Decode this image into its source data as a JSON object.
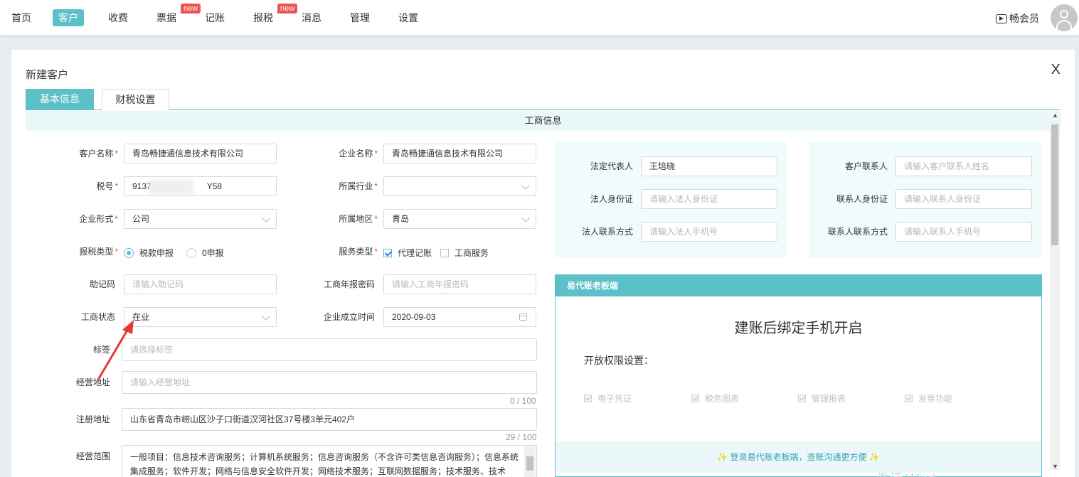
{
  "nav": {
    "items": [
      {
        "label": "首页",
        "active": false
      },
      {
        "label": "客户",
        "active": true
      },
      {
        "label": "收费",
        "active": false
      },
      {
        "label": "票据",
        "active": false,
        "badge": "new"
      },
      {
        "label": "记账",
        "active": false
      },
      {
        "label": "报税",
        "active": false,
        "badge": "new"
      },
      {
        "label": "消息",
        "active": false
      },
      {
        "label": "管理",
        "active": false
      },
      {
        "label": "设置",
        "active": false
      }
    ],
    "vip_label": "畅会员"
  },
  "modal": {
    "title": "新建客户",
    "close": "X",
    "tabs": [
      "基本信息",
      "财税设置"
    ],
    "section_title": "工商信息"
  },
  "form": {
    "customer_name": {
      "label": "客户名称",
      "value": "青岛畅捷通信息技术有限公司"
    },
    "company_name": {
      "label": "企业名称",
      "value": "青岛畅捷通信息技术有限公司"
    },
    "tax_no": {
      "label": "税号",
      "value_start": "9137",
      "value_end": "Y58"
    },
    "industry": {
      "label": "所属行业",
      "value": ""
    },
    "company_form": {
      "label": "企业形式",
      "value": "公司"
    },
    "region": {
      "label": "所属地区",
      "value": "青岛"
    },
    "tax_type": {
      "label": "报税类型",
      "options": [
        "税款申报",
        "0申报"
      ],
      "selected": "税款申报"
    },
    "service_type": {
      "label": "服务类型",
      "options": [
        "代理记账",
        "工商服务"
      ],
      "checked": [
        "代理记账"
      ]
    },
    "mnemonic": {
      "label": "助记码",
      "placeholder": "请输入助记码"
    },
    "annual_report_pwd": {
      "label": "工商年报密码",
      "placeholder": "请输入工商年报密码"
    },
    "biz_status": {
      "label": "工商状态",
      "value": "在业"
    },
    "founded": {
      "label": "企业成立时间",
      "value": "2020-09-03"
    },
    "tags": {
      "label": "标签",
      "placeholder": "请选择标签"
    },
    "biz_address": {
      "label": "经营地址",
      "placeholder": "请输入经营地址",
      "counter": "0 / 100"
    },
    "reg_address": {
      "label": "注册地址",
      "value": "山东省青岛市崂山区沙子口街道汉河社区37号楼3单元402户",
      "counter": "29 / 100"
    },
    "biz_scope": {
      "label": "经营范围",
      "value": "一般项目：信息技术咨询服务；计算机系统服务；信息咨询服务（不含许可类信息咨询服务）；信息系统集成服务；软件开发；网络与信息安全软件开发；网络技术服务；互联网数据服务；技术服务、技术"
    }
  },
  "legal": {
    "rep": {
      "label": "法定代表人",
      "value": "王培晓"
    },
    "id": {
      "label": "法人身份证",
      "placeholder": "请输入法人身份证"
    },
    "contact": {
      "label": "法人联系方式",
      "placeholder": "请输入法人手机号"
    }
  },
  "contact": {
    "name": {
      "label": "客户联系人",
      "placeholder": "请输入客户联系人姓名"
    },
    "id": {
      "label": "联系人身份证",
      "placeholder": "请输入联系人身份证"
    },
    "phone": {
      "label": "联系人联系方式",
      "placeholder": "请输入联系人手机号"
    }
  },
  "boss_panel": {
    "header": "易代账老板端",
    "headline": "建账后绑定手机开启",
    "perm_title": "开放权限设置：",
    "perms": [
      "电子凭证",
      "税务图表",
      "管理报表",
      "发票功能"
    ],
    "footer": "登录易代账老板端，查账沟通更方便"
  },
  "watermark": "激活 Wind",
  "colors": {
    "accent": "#5bc0c8",
    "required": "#e84a4a",
    "badge": "#ef5350"
  }
}
